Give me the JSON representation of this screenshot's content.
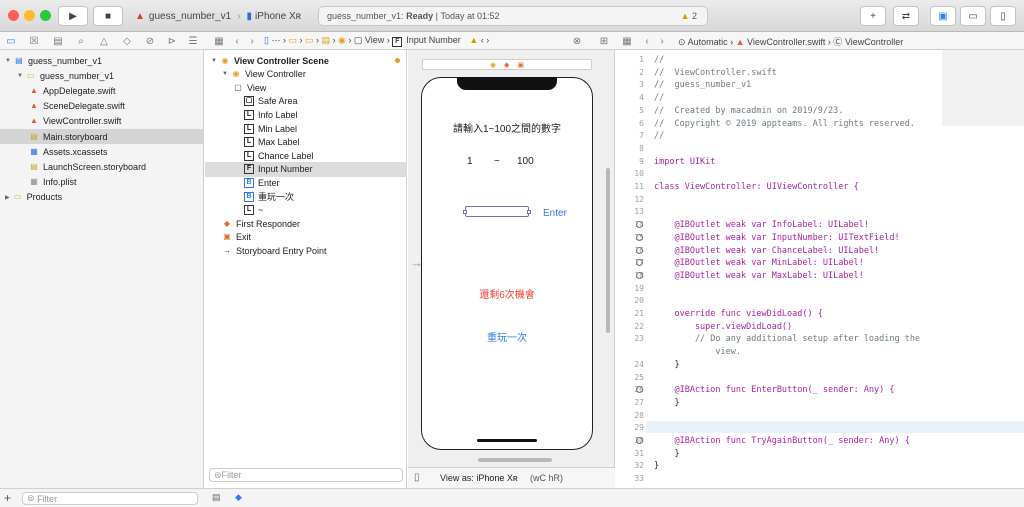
{
  "toolbar": {
    "scheme": "guess_number_v1",
    "device": "iPhone Xʀ",
    "status_app": "guess_number_v1:",
    "status_state": "Ready",
    "status_time": "Today at 01:52",
    "warnings": "2"
  },
  "jump": {
    "b1": "⋯",
    "b2": "⋯",
    "view": "View",
    "field": "Input Number",
    "automatic": "Automatic",
    "file": "ViewController.swift",
    "cls": "ViewController"
  },
  "navigator": {
    "items": [
      {
        "label": "guess_number_v1",
        "level": 0,
        "icon": "project-icon"
      },
      {
        "label": "guess_number_v1",
        "level": 1,
        "icon": "folder-icon"
      },
      {
        "label": "AppDelegate.swift",
        "level": 2,
        "icon": "swift-file-icon"
      },
      {
        "label": "SceneDelegate.swift",
        "level": 2,
        "icon": "swift-file-icon"
      },
      {
        "label": "ViewController.swift",
        "level": 2,
        "icon": "swift-file-icon"
      },
      {
        "label": "Main.storyboard",
        "level": 2,
        "icon": "storyboard-icon",
        "selected": true
      },
      {
        "label": "Assets.xcassets",
        "level": 2,
        "icon": "assets-icon"
      },
      {
        "label": "LaunchScreen.storyboard",
        "level": 2,
        "icon": "storyboard-icon"
      },
      {
        "label": "Info.plist",
        "level": 2,
        "icon": "plist-icon"
      },
      {
        "label": "Products",
        "level": 0,
        "icon": "folder-icon"
      }
    ],
    "filter_placeholder": "Filter"
  },
  "outline": {
    "items": [
      {
        "label": "View Controller Scene",
        "level": 0,
        "badge": "",
        "bold": true
      },
      {
        "label": "View Controller",
        "level": 1,
        "badge": ""
      },
      {
        "label": "View",
        "level": 2,
        "badge": ""
      },
      {
        "label": "Safe Area",
        "level": 3,
        "badge": "▢"
      },
      {
        "label": "Info Label",
        "level": 3,
        "badge": "L"
      },
      {
        "label": "Min Label",
        "level": 3,
        "badge": "L"
      },
      {
        "label": "Max Label",
        "level": 3,
        "badge": "L"
      },
      {
        "label": "Chance Label",
        "level": 3,
        "badge": "L"
      },
      {
        "label": "Input Number",
        "level": 3,
        "badge": "F",
        "selected": true
      },
      {
        "label": "Enter",
        "level": 3,
        "badge": "B"
      },
      {
        "label": "重玩一次",
        "level": 3,
        "badge": "B"
      },
      {
        "label": "~",
        "level": 3,
        "badge": "L"
      },
      {
        "label": "First Responder",
        "level": 1,
        "badge": ""
      },
      {
        "label": "Exit",
        "level": 1,
        "badge": ""
      },
      {
        "label": "Storyboard Entry Point",
        "level": 1,
        "badge": ""
      }
    ],
    "filter_placeholder": "Filter"
  },
  "phone": {
    "info": "請輸入1~100之間的數字",
    "min": "1",
    "tilde": "~",
    "max": "100",
    "enter": "Enter",
    "chance": "還剩6次機會",
    "retry": "重玩一次"
  },
  "canvas_footer": {
    "view_as": "View as: iPhone Xʀ",
    "wc": "(wC hR)"
  },
  "code": [
    {
      "n": "1",
      "t": "//",
      "c": "cm"
    },
    {
      "n": "2",
      "t": "//  ViewController.swift",
      "c": "cm"
    },
    {
      "n": "3",
      "t": "//  guess_number_v1",
      "c": "cm"
    },
    {
      "n": "4",
      "t": "//",
      "c": "cm"
    },
    {
      "n": "5",
      "t": "//  Created by macadmin on 2019/9/23.",
      "c": "cm"
    },
    {
      "n": "6",
      "t": "//  Copyright © 2019 appteams. All rights reserved.",
      "c": "cm"
    },
    {
      "n": "7",
      "t": "//",
      "c": "cm"
    },
    {
      "n": "8",
      "t": ""
    },
    {
      "n": "9",
      "t": "import UIKit",
      "c": "kw"
    },
    {
      "n": "10",
      "t": ""
    },
    {
      "n": "11",
      "t": "class ViewController: UIViewController {",
      "c": "kw"
    },
    {
      "n": "12",
      "t": ""
    },
    {
      "n": "13",
      "t": ""
    },
    {
      "n": "14",
      "t": "    @IBOutlet weak var InfoLabel: UILabel!",
      "c": "kw",
      "dot": true
    },
    {
      "n": "15",
      "t": "    @IBOutlet weak var InputNumber: UITextField!",
      "c": "kw",
      "dot": true
    },
    {
      "n": "16",
      "t": "    @IBOutlet weak var ChanceLabel: UILabel!",
      "c": "kw",
      "dot": true
    },
    {
      "n": "17",
      "t": "    @IBOutlet weak var MinLabel: UILabel!",
      "c": "kw",
      "dot": true
    },
    {
      "n": "18",
      "t": "    @IBOutlet weak var MaxLabel: UILabel!",
      "c": "kw",
      "dot": true
    },
    {
      "n": "19",
      "t": ""
    },
    {
      "n": "20",
      "t": ""
    },
    {
      "n": "21",
      "t": "    override func viewDidLoad() {",
      "c": "kw"
    },
    {
      "n": "22",
      "t": "        super.viewDidLoad()",
      "c": "kw"
    },
    {
      "n": "23",
      "t": "        // Do any additional setup after loading the",
      "c": "cm"
    },
    {
      "n": "",
      "t": "            view.",
      "c": "cm"
    },
    {
      "n": "24",
      "t": "    }"
    },
    {
      "n": "25",
      "t": ""
    },
    {
      "n": "26",
      "t": "    @IBAction func EnterButton(_ sender: Any) {",
      "c": "kw",
      "dot": true
    },
    {
      "n": "27",
      "t": "    }"
    },
    {
      "n": "28",
      "t": ""
    },
    {
      "n": "29",
      "t": "",
      "hl": true
    },
    {
      "n": "30",
      "t": "    @IBAction func TryAgainButton(_ sender: Any) {",
      "c": "kw",
      "dot": true
    },
    {
      "n": "31",
      "t": "    }"
    },
    {
      "n": "32",
      "t": "}"
    },
    {
      "n": "33",
      "t": ""
    }
  ],
  "colors": {
    "accent": "#2f7bf6",
    "red": "#ff3b30",
    "selection": "#dcdcdc"
  }
}
